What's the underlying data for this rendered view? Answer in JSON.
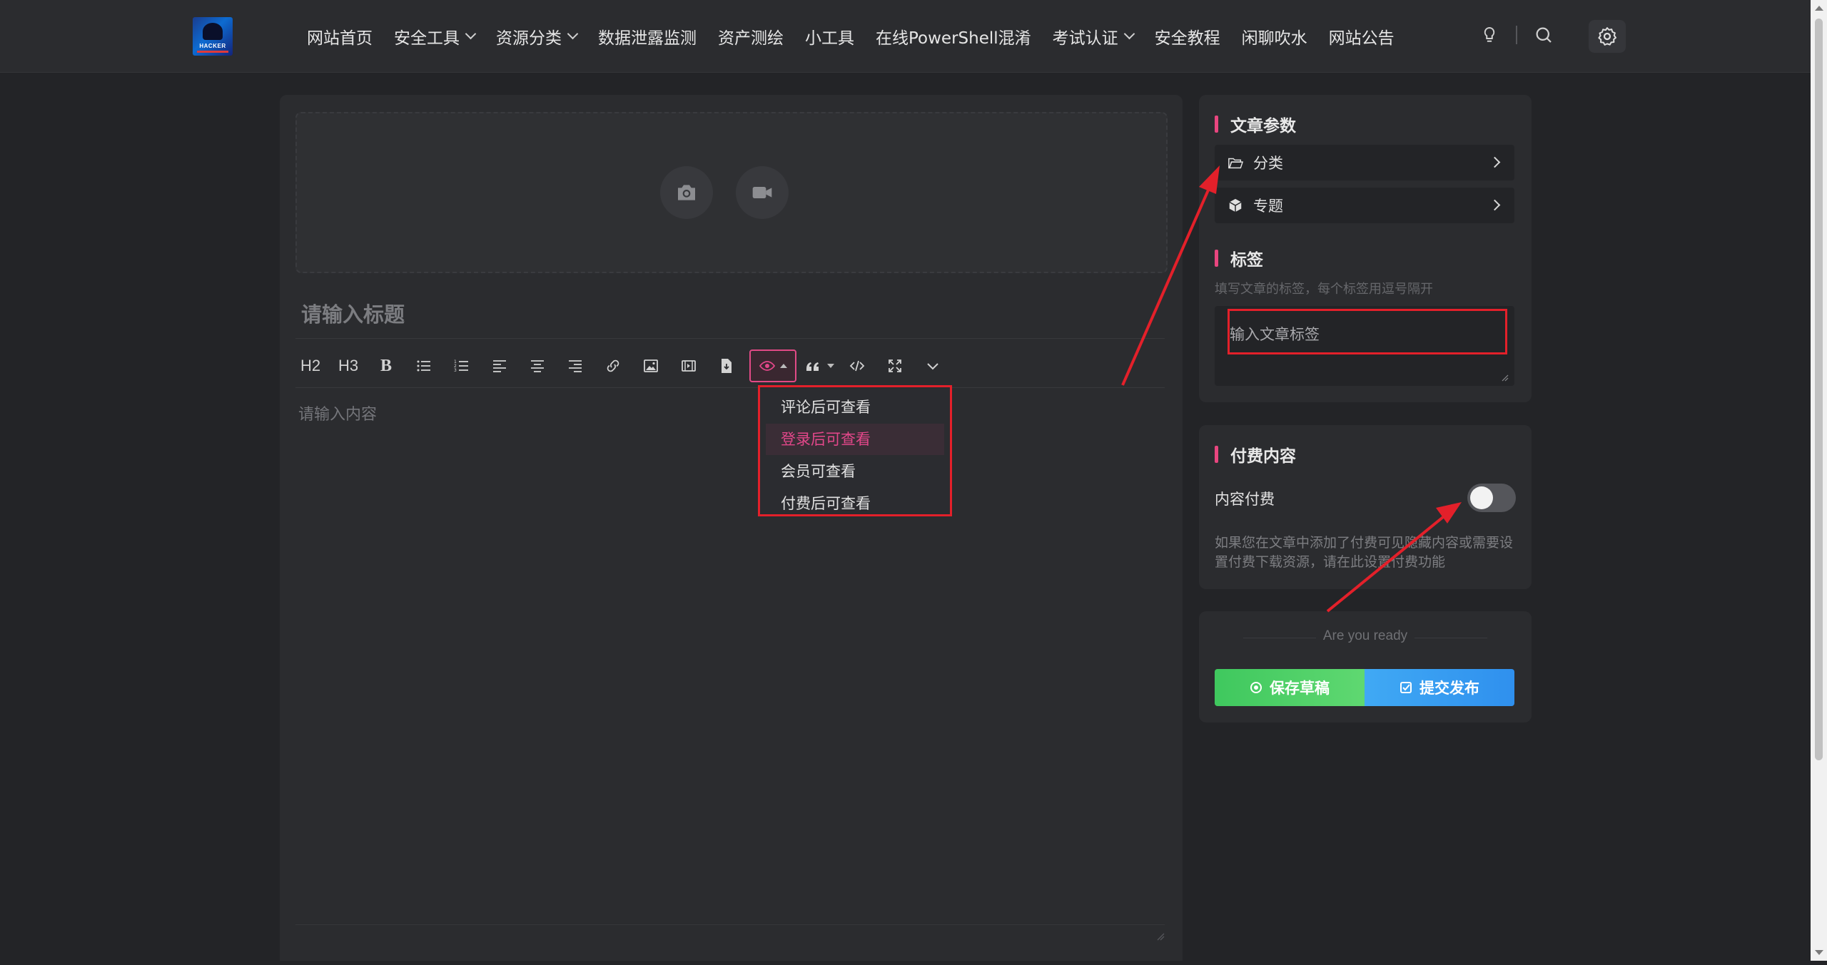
{
  "nav": {
    "logo_text": "HACKER",
    "items": [
      {
        "label": "网站首页",
        "dropdown": false
      },
      {
        "label": "安全工具",
        "dropdown": true
      },
      {
        "label": "资源分类",
        "dropdown": true
      },
      {
        "label": "数据泄露监测",
        "dropdown": false
      },
      {
        "label": "资产测绘",
        "dropdown": false
      },
      {
        "label": "小工具",
        "dropdown": false
      },
      {
        "label": "在线PowerShell混淆",
        "dropdown": false
      },
      {
        "label": "考试认证",
        "dropdown": true
      },
      {
        "label": "安全教程",
        "dropdown": false
      },
      {
        "label": "闲聊吹水",
        "dropdown": false
      },
      {
        "label": "网站公告",
        "dropdown": false
      }
    ],
    "icons": [
      "lightbulb-icon",
      "search-icon",
      "gear-icon"
    ]
  },
  "editor": {
    "title_placeholder": "请输入标题",
    "content_placeholder": "请输入内容",
    "toolbar": {
      "h2": "H2",
      "h3": "H3",
      "bold": "B"
    },
    "hide_menu": {
      "items": [
        {
          "label": "评论后可查看",
          "selected": false
        },
        {
          "label": "登录后可查看",
          "selected": true
        },
        {
          "label": "会员可查看",
          "selected": false
        },
        {
          "label": "付费后可查看",
          "selected": false
        }
      ]
    }
  },
  "sidebar": {
    "params": {
      "title": "文章参数",
      "category_label": "分类",
      "topic_label": "专题"
    },
    "tags": {
      "title": "标签",
      "hint": "填写文章的标签，每个标签用逗号隔开",
      "placeholder": "输入文章标签"
    },
    "paid": {
      "title": "付费内容",
      "toggle_label": "内容付费",
      "toggle_on": false,
      "hint": "如果您在文章中添加了付费可见隐藏内容或需要设置付费下载资源，请在此设置付费功能"
    },
    "publish": {
      "ready_text": "Are you ready",
      "draft_label": "保存草稿",
      "submit_label": "提交发布"
    }
  },
  "colors": {
    "accent_pink": "#e8467f",
    "highlight_red": "#e3202a",
    "draft_green": "#4ccf66",
    "publish_blue": "#389df1"
  }
}
